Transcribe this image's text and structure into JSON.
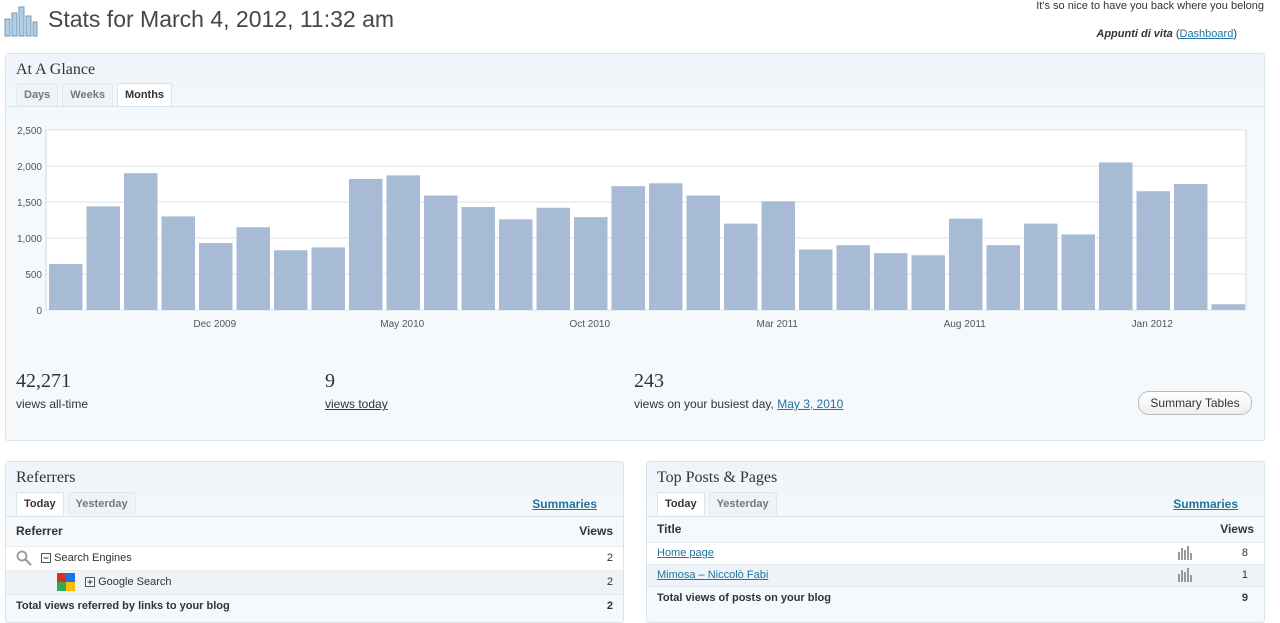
{
  "header": {
    "title": "Stats for March 4, 2012, 11:32 am",
    "tagline": "It's so nice to have you back where you belong",
    "blog_name": "Appunti di vita",
    "dashboard_link": "Dashboard"
  },
  "glance": {
    "title": "At A Glance",
    "tabs": [
      "Days",
      "Weeks",
      "Months"
    ],
    "active_tab": "Months",
    "stats": {
      "views_all_time": "42,271",
      "views_all_time_label": "views all-time",
      "views_today": "9",
      "views_today_label": "views today",
      "busiest_day_views": "243",
      "busiest_day_label": "views on your busiest day,",
      "busiest_day_date": "May 3, 2010"
    },
    "summary_button": "Summary Tables"
  },
  "chart_data": {
    "type": "bar",
    "ylim": [
      0,
      2500
    ],
    "yticks": [
      "0",
      "500",
      "1,000",
      "1,500",
      "2,000",
      "2,500"
    ],
    "ytick_values": [
      0,
      500,
      1000,
      1500,
      2000,
      2500
    ],
    "xtick_labels": [
      "Dec 2009",
      "May 2010",
      "Oct 2010",
      "Mar 2011",
      "Aug 2011",
      "Jan 2012"
    ],
    "xtick_bar_index": [
      4,
      9,
      14,
      19,
      24,
      29
    ],
    "values": [
      640,
      1440,
      1900,
      1300,
      930,
      1150,
      830,
      870,
      1820,
      1870,
      1590,
      1430,
      1260,
      1420,
      1290,
      1720,
      1760,
      1590,
      1200,
      1510,
      840,
      900,
      790,
      760,
      1270,
      900,
      1200,
      1050,
      2050,
      1650,
      1750,
      80
    ],
    "bar_color": "#a7bcd4",
    "grid": true
  },
  "referrers": {
    "title": "Referrers",
    "tabs": [
      "Today",
      "Yesterday"
    ],
    "active_tab": "Today",
    "summaries": "Summaries",
    "col_referrer": "Referrer",
    "col_views": "Views",
    "rows": [
      {
        "label": "Search Engines",
        "views": "2"
      },
      {
        "label": "Google Search",
        "views": "2"
      }
    ],
    "total_label": "Total views referred by links to your blog",
    "total_views": "2"
  },
  "top_posts": {
    "title": "Top Posts & Pages",
    "tabs": [
      "Today",
      "Yesterday"
    ],
    "active_tab": "Today",
    "summaries": "Summaries",
    "col_title": "Title",
    "col_views": "Views",
    "rows": [
      {
        "title": "Home page",
        "views": "8"
      },
      {
        "title": "Mimosa – Niccolò Fabi",
        "views": "1"
      }
    ],
    "total_label": "Total views of posts on your blog",
    "total_views": "9"
  }
}
